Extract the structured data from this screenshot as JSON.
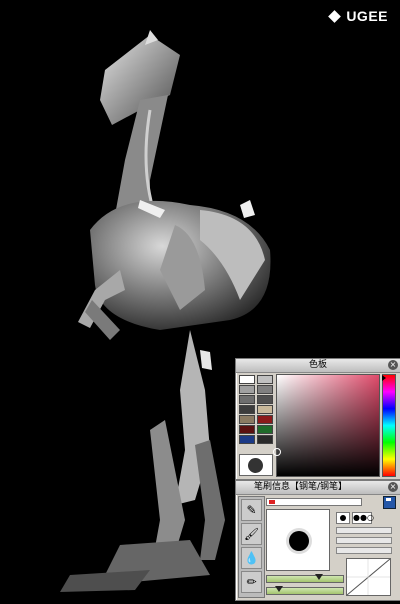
{
  "brand": {
    "logo_text": "UGEE"
  },
  "color_panel": {
    "title": "色板",
    "close_icon": "close-icon",
    "swatches": [
      "#ffffff",
      "#c0c0c0",
      "#a0a0a0",
      "#808080",
      "#6e6e6e",
      "#505050",
      "#3c3c3c",
      "#c8b89a",
      "#8a7a62",
      "#8b1a1a",
      "#5a1010",
      "#1f6b2a",
      "#1c3a86",
      "#2a2a2a"
    ],
    "current_color": "#333333",
    "hue_color": "#e04b6b"
  },
  "brush_panel": {
    "title": "笔刷信息【钢笔/钢笔】",
    "save_icon": "save-icon",
    "tools": [
      "pen-tool-icon",
      "brush-tool-icon",
      "dropper-tool-icon",
      "marker-tool-icon"
    ],
    "mode_dots": "●●○"
  }
}
